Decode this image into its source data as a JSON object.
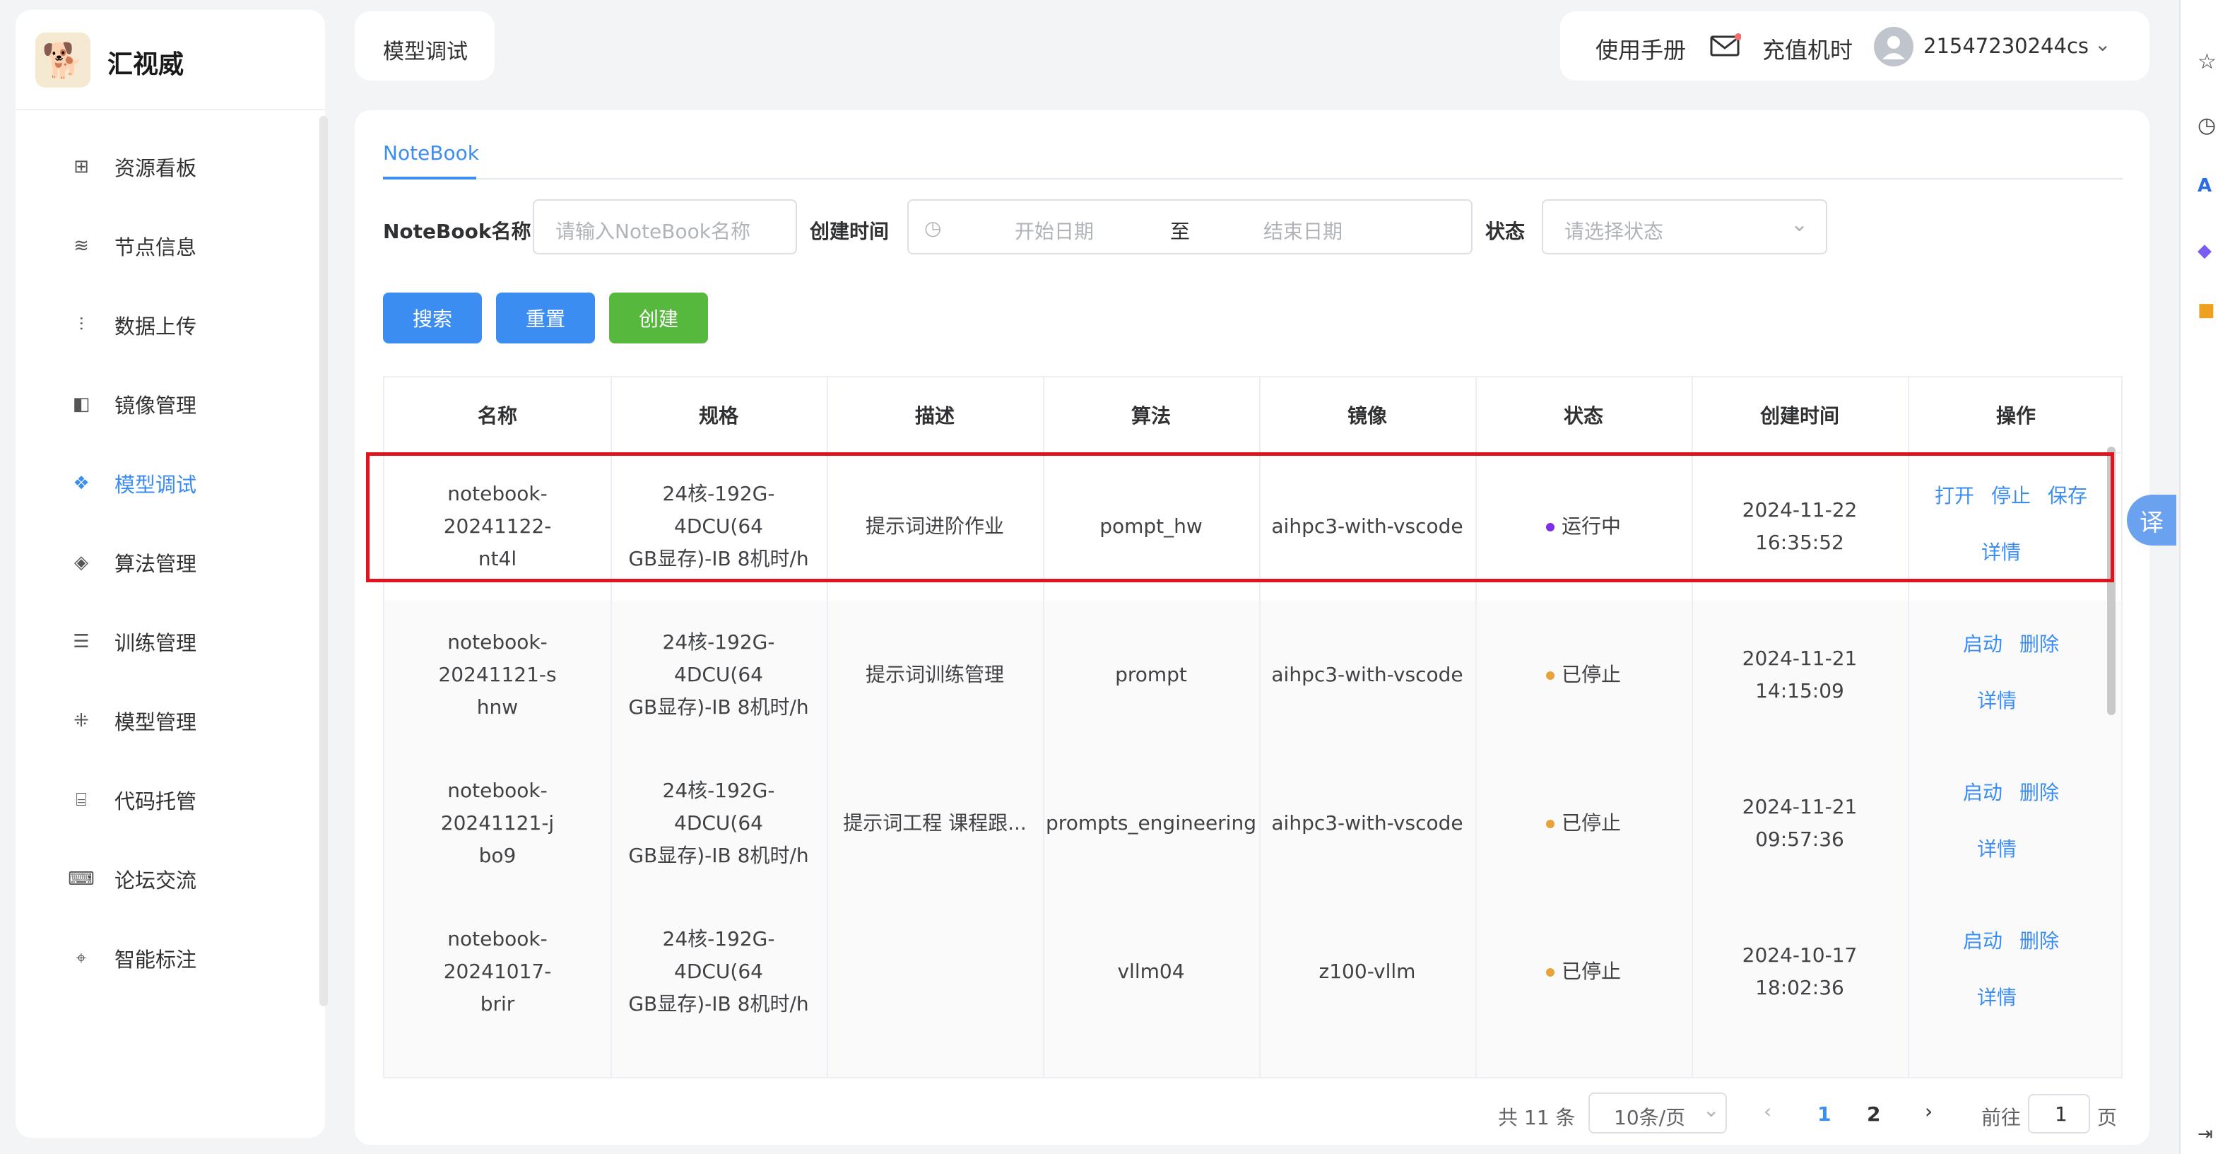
{
  "app": {
    "name": "汇视威",
    "logo_icon": "dog-logo-icon"
  },
  "sidebar": {
    "items": [
      {
        "label": "资源看板",
        "icon": "grid-icon",
        "glyph": "⊞",
        "active": false
      },
      {
        "label": "节点信息",
        "icon": "sliders-icon",
        "glyph": "≋",
        "active": false
      },
      {
        "label": "数据上传",
        "icon": "chart-icon",
        "glyph": "⫶",
        "active": false
      },
      {
        "label": "镜像管理",
        "icon": "mirror-icon",
        "glyph": "◧",
        "active": false
      },
      {
        "label": "模型调试",
        "icon": "cube-icon",
        "glyph": "❖",
        "active": true
      },
      {
        "label": "算法管理",
        "icon": "box-icon",
        "glyph": "◈",
        "active": false
      },
      {
        "label": "训练管理",
        "icon": "server-icon",
        "glyph": "☰",
        "active": false
      },
      {
        "label": "模型管理",
        "icon": "network-icon",
        "glyph": "⁜",
        "active": false
      },
      {
        "label": "代码托管",
        "icon": "code-icon",
        "glyph": "⌸",
        "active": false
      },
      {
        "label": "论坛交流",
        "icon": "chat-icon",
        "glyph": "⌨",
        "active": false
      },
      {
        "label": "智能标注",
        "icon": "tag-icon",
        "glyph": "⌖",
        "active": false
      }
    ]
  },
  "header": {
    "breadcrumb": "模型调试",
    "manual": "使用手册",
    "recharge": "充值机时",
    "username": "21547230244cs"
  },
  "tabs": [
    {
      "label": "NoteBook",
      "active": true
    }
  ],
  "filters": {
    "name_label": "NoteBook名称",
    "name_placeholder": "请输入NoteBook名称",
    "time_label": "创建时间",
    "start_placeholder": "开始日期",
    "range_sep": "至",
    "end_placeholder": "结束日期",
    "status_label": "状态",
    "status_placeholder": "请选择状态"
  },
  "buttons": {
    "search": "搜索",
    "reset": "重置",
    "create": "创建"
  },
  "colors": {
    "primary": "#3c8df2",
    "success": "#57b83e",
    "running": "#7d2ee6",
    "stopped": "#e6a23c",
    "highlight": "#e0141f"
  },
  "table": {
    "headers": [
      "名称",
      "规格",
      "描述",
      "算法",
      "镜像",
      "状态",
      "创建时间",
      "操作"
    ],
    "rows": [
      {
        "name_l1": "notebook-20241122-",
        "name_l2": "nt4l",
        "spec_l1": "24核-192G-4DCU(64",
        "spec_l2": "GB显存)-IB 8机时/h",
        "desc": "提示词进阶作业",
        "algo": "pompt_hw",
        "image": "aihpc3-with-vscode",
        "status": "运行中",
        "status_type": "running",
        "created": "2024-11-22 16:35:52",
        "ops": [
          "打开",
          "停止",
          "保存"
        ],
        "detail": "详情"
      },
      {
        "name_l1": "notebook-20241121-s",
        "name_l2": "hnw",
        "spec_l1": "24核-192G-4DCU(64",
        "spec_l2": "GB显存)-IB 8机时/h",
        "desc": "提示词训练管理",
        "algo": "prompt",
        "image": "aihpc3-with-vscode",
        "status": "已停止",
        "status_type": "stopped",
        "created": "2024-11-21 14:15:09",
        "ops": [
          "启动",
          "删除"
        ],
        "detail": "详情"
      },
      {
        "name_l1": "notebook-20241121-j",
        "name_l2": "bo9",
        "spec_l1": "24核-192G-4DCU(64",
        "spec_l2": "GB显存)-IB 8机时/h",
        "desc": "提示词工程 课程跟...",
        "algo": "prompts_engineering",
        "image": "aihpc3-with-vscode",
        "status": "已停止",
        "status_type": "stopped",
        "created": "2024-11-21 09:57:36",
        "ops": [
          "启动",
          "删除"
        ],
        "detail": "详情"
      },
      {
        "name_l1": "notebook-20241017-",
        "name_l2": "brir",
        "spec_l1": "24核-192G-4DCU(64",
        "spec_l2": "GB显存)-IB 8机时/h",
        "desc": "",
        "algo": "vllm04",
        "image": "z100-vllm",
        "status": "已停止",
        "status_type": "stopped",
        "created": "2024-10-17 18:02:36",
        "ops": [
          "启动",
          "删除"
        ],
        "detail": "详情"
      }
    ]
  },
  "pagination": {
    "total": "共 11 条",
    "page_size": "10条/页",
    "pages": [
      "1",
      "2"
    ],
    "current": "1",
    "goto_label": "前往",
    "goto_value": "1",
    "page_suffix": "页"
  },
  "translate_label": "译"
}
